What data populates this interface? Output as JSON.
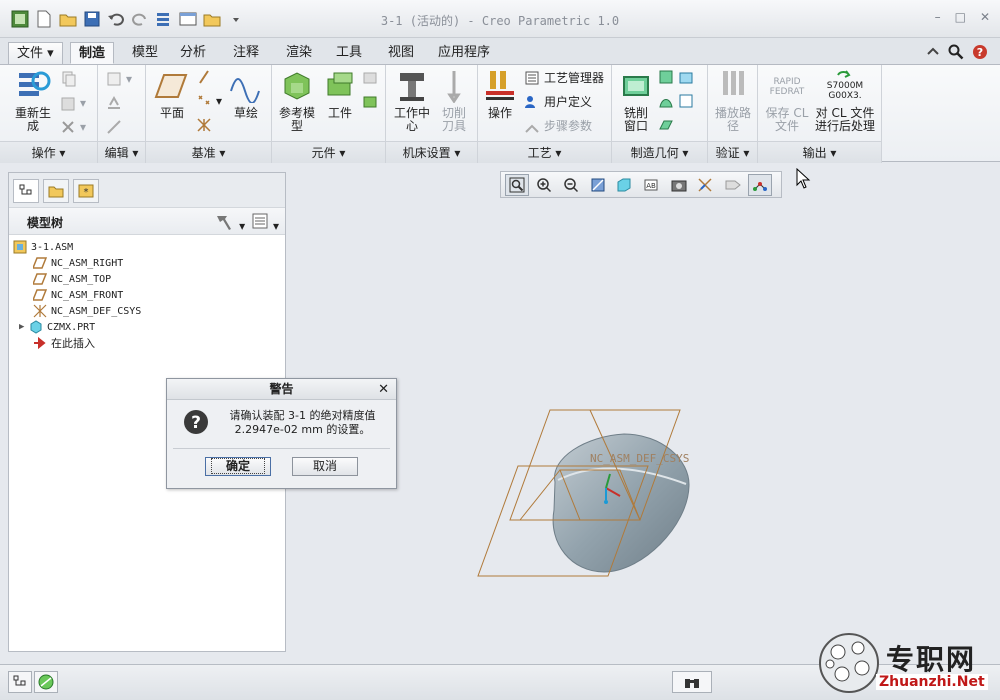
{
  "window": {
    "title": "3-1 (活动的) - Creo Parametric 1.0"
  },
  "tabs": {
    "file": "文件",
    "items": [
      "制造",
      "模型",
      "分析",
      "注释",
      "渲染",
      "工具",
      "视图",
      "应用程序"
    ]
  },
  "ribbon": {
    "ops": {
      "regen": "重新生\n成",
      "label": "操作"
    },
    "edit": {
      "label": "编辑"
    },
    "datum": {
      "plane": "平面",
      "sketch": "草绘",
      "label": "基准"
    },
    "component": {
      "ref_model": "参考模\n型",
      "workpiece": "工件",
      "label": "元件"
    },
    "machine": {
      "work_center": "工作中\n心",
      "cutter": "切削\n刀具",
      "label": "机床设置"
    },
    "process": {
      "operation": "操作",
      "process_mgr": "工艺管理器",
      "user_def": "用户定义",
      "step_params": "步骤参数",
      "label": "工艺"
    },
    "mfg_geom": {
      "mill_window": "铣削\n窗口",
      "label": "制造几何"
    },
    "verify": {
      "play_path": "播放路\n径",
      "label": "验证"
    },
    "output": {
      "rapid": "RAPID",
      "fedrat": "FEDRAT",
      "save_cl": "保存 CL\n文件",
      "s7000": "S7000M\nG00X3.",
      "post": "对 CL 文件\n进行后处理",
      "label": "输出"
    }
  },
  "model_tree": {
    "title": "模型树",
    "items": [
      {
        "label": "3-1.ASM",
        "icon": "assembly-icon"
      },
      {
        "label": "NC_ASM_RIGHT",
        "icon": "datum-plane-icon"
      },
      {
        "label": "NC_ASM_TOP",
        "icon": "datum-plane-icon"
      },
      {
        "label": "NC_ASM_FRONT",
        "icon": "datum-plane-icon"
      },
      {
        "label": "NC_ASM_DEF_CSYS",
        "icon": "csys-icon"
      },
      {
        "label": "CZMX.PRT",
        "icon": "part-icon"
      },
      {
        "label": "在此插入",
        "icon": "insert-arrow-icon"
      }
    ]
  },
  "viewport": {
    "csys_label": "NC_ASM_DEF_CSYS"
  },
  "dialog": {
    "title": "警告",
    "message": "请确认装配 3-1 的绝对精度值\n2.2947e-02 mm 的设置。",
    "ok": "确定",
    "cancel": "取消"
  },
  "watermark": {
    "text": "专职网",
    "url": "Zhuanzhi.Net"
  },
  "colors": {
    "datum": "#b07a3a",
    "part": "#93a3ad",
    "accent": "#2a66c5"
  }
}
